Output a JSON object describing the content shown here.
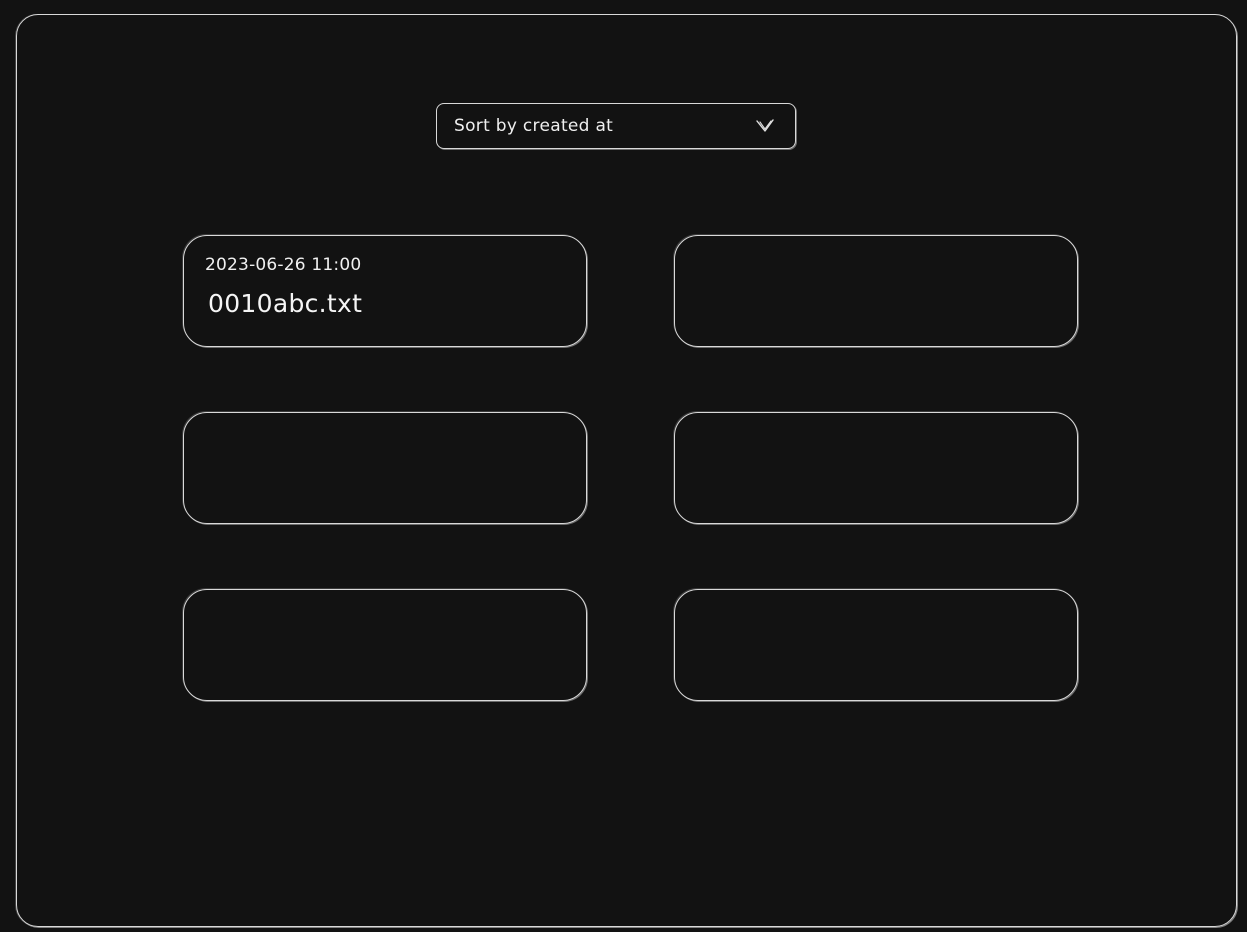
{
  "sort": {
    "selected_label": "Sort by created at",
    "icon": "chevron-down-icon"
  },
  "files": [
    {
      "date": "2023-06-26 11:00",
      "name": "0010abc.txt"
    },
    {
      "date": "",
      "name": ""
    },
    {
      "date": "",
      "name": ""
    },
    {
      "date": "",
      "name": ""
    },
    {
      "date": "",
      "name": ""
    },
    {
      "date": "",
      "name": ""
    }
  ],
  "colors": {
    "background": "#121212",
    "stroke": "#d9d9d9",
    "text": "#f0f0f0"
  }
}
